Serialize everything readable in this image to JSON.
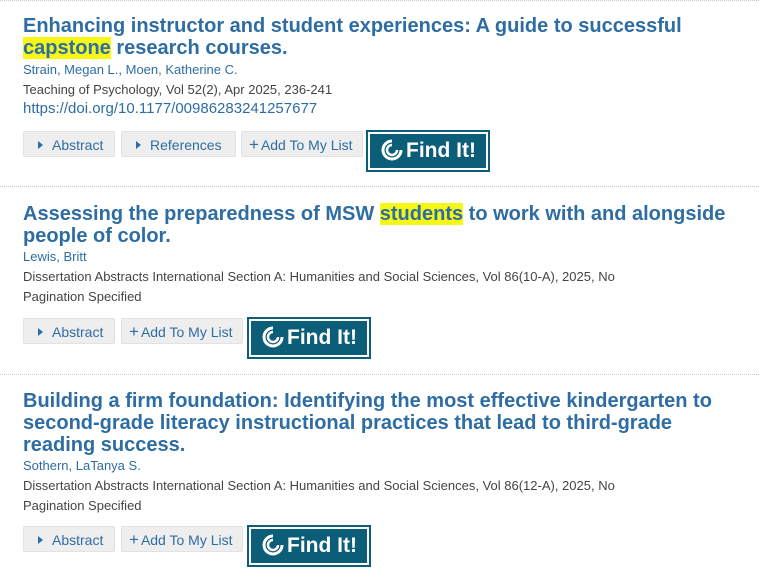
{
  "results": [
    {
      "title_pre": "Enhancing instructor and student experiences: A guide to successful ",
      "title_hl": "capstone",
      "title_post": " research courses.",
      "authors": "Strain, Megan L., Moen, Katherine C.",
      "source": "Teaching of Psychology, Vol 52(2), Apr 2025, 236-241",
      "doi": "https://doi.org/10.1177/00986283241257677",
      "buttons": {
        "abstract": "Abstract",
        "references": "References",
        "add": "Add To My List",
        "findit": "Find It!"
      }
    },
    {
      "title_pre": "Assessing the preparedness of MSW ",
      "title_hl": "students",
      "title_post": " to work with and alongside people of color.",
      "authors": "Lewis, Britt",
      "source": "Dissertation Abstracts International Section A: Humanities and Social Sciences, Vol 86(10-A), 2025, No Pagination Specified",
      "buttons": {
        "abstract": "Abstract",
        "add": "Add To My List",
        "findit": "Find It!"
      }
    },
    {
      "title": "Building a firm foundation: Identifying the most effective kindergarten to second-grade literacy instructional practices that lead to third-grade reading success.",
      "authors": "Sothern, LaTanya S.",
      "source": "Dissertation Abstracts International Section A: Humanities and Social Sciences, Vol 86(12-A), 2025, No Pagination Specified",
      "buttons": {
        "abstract": "Abstract",
        "add": "Add To My List",
        "findit": "Find It!"
      }
    }
  ],
  "icons": {
    "caret": "caret-right-icon",
    "plus": "plus-icon",
    "findit_logo": "findit-swirl-icon"
  },
  "colors": {
    "link": "#2d6da3",
    "highlight": "#f7f716",
    "findit_bg": "#0b5d78"
  }
}
